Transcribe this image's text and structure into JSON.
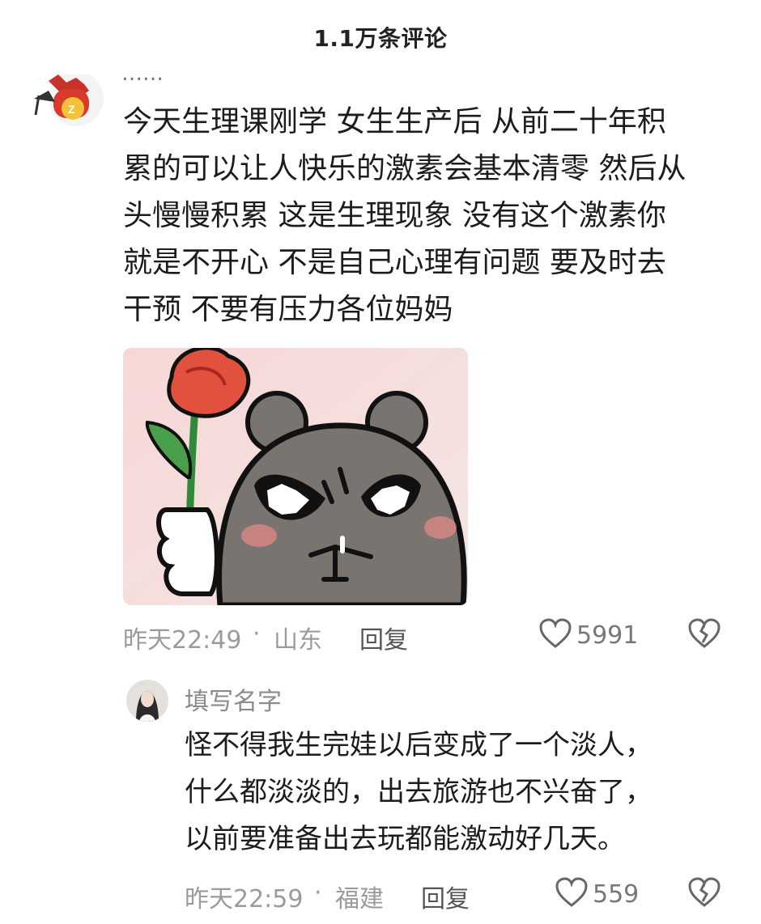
{
  "header": {
    "title": "1.1万条评论"
  },
  "comment": {
    "username": "……",
    "lines": [
      "今天生理课刚学 女生生产后 从前二十年积",
      "累的可以让人快乐的激素会基本清零 然后从",
      "头慢慢积累 这是生理现象 没有这个激素你",
      "就是不开心  不是自己心理有问题 要及时去",
      "干预 不要有压力各位妈妈"
    ],
    "time": "昨天22:49",
    "separator": "·",
    "location": "山东",
    "reply_label": "回复",
    "likes": "5991",
    "icons": {
      "like": "heart-icon",
      "dislike": "broken-heart-icon",
      "avatar": "cartoon-avatar-icon",
      "sticker": "angry-bear-rose-sticker"
    }
  },
  "reply": {
    "username": "填写名字",
    "lines": [
      "怪不得我生完娃以后变成了一个淡人，",
      "什么都淡淡的，出去旅游也不兴奋了，",
      "以前要准备出去玩都能激动好几天。"
    ],
    "time": "昨天22:59",
    "separator": "·",
    "location": "福建",
    "reply_label": "回复",
    "likes": "559"
  }
}
